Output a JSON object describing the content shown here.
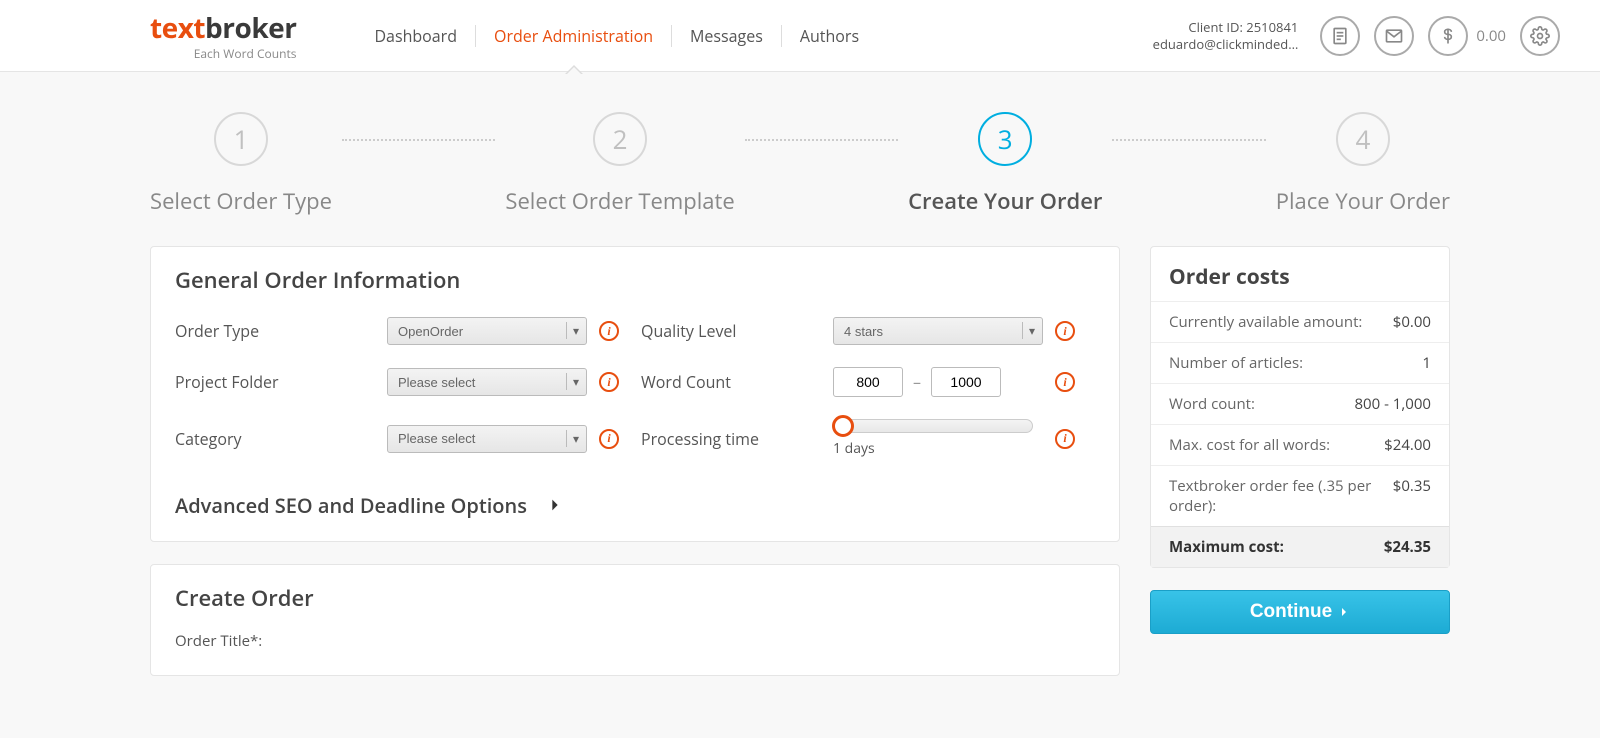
{
  "logo": {
    "part1": "text",
    "part2": "broker",
    "tagline": "Each Word Counts"
  },
  "nav": {
    "dashboard": "Dashboard",
    "order_admin": "Order Administration",
    "messages": "Messages",
    "authors": "Authors"
  },
  "client": {
    "id_label": "Client ID: 2510841",
    "email": "eduardo@clickminded…"
  },
  "balance": "0.00",
  "steps": {
    "s1": {
      "num": "1",
      "label": "Select Order Type"
    },
    "s2": {
      "num": "2",
      "label": "Select Order Template"
    },
    "s3": {
      "num": "3",
      "label": "Create Your Order"
    },
    "s4": {
      "num": "4",
      "label": "Place Your Order"
    }
  },
  "general": {
    "title": "General Order Information",
    "order_type_label": "Order Type",
    "order_type_value": "OpenOrder",
    "project_folder_label": "Project Folder",
    "project_folder_value": "Please select",
    "category_label": "Category",
    "category_value": "Please select",
    "quality_label": "Quality Level",
    "quality_value": "4 stars",
    "word_count_label": "Word Count",
    "word_min": "800",
    "word_max": "1000",
    "processing_label": "Processing time",
    "processing_value": "1 days",
    "advanced_label": "Advanced SEO and Deadline Options"
  },
  "create": {
    "title": "Create Order",
    "order_title_label": "Order Title*:"
  },
  "costs": {
    "title": "Order costs",
    "available_label": "Currently available amount:",
    "available_value": "$0.00",
    "articles_label": "Number of articles:",
    "articles_value": "1",
    "wordcount_label": "Word count:",
    "wordcount_value": "800 - 1,000",
    "max_label": "Max. cost for all words:",
    "max_value": "$24.00",
    "fee_label": "Textbroker order fee (.35 per order):",
    "fee_value": "$0.35",
    "total_label": "Maximum cost:",
    "total_value": "$24.35"
  },
  "continue": "Continue"
}
